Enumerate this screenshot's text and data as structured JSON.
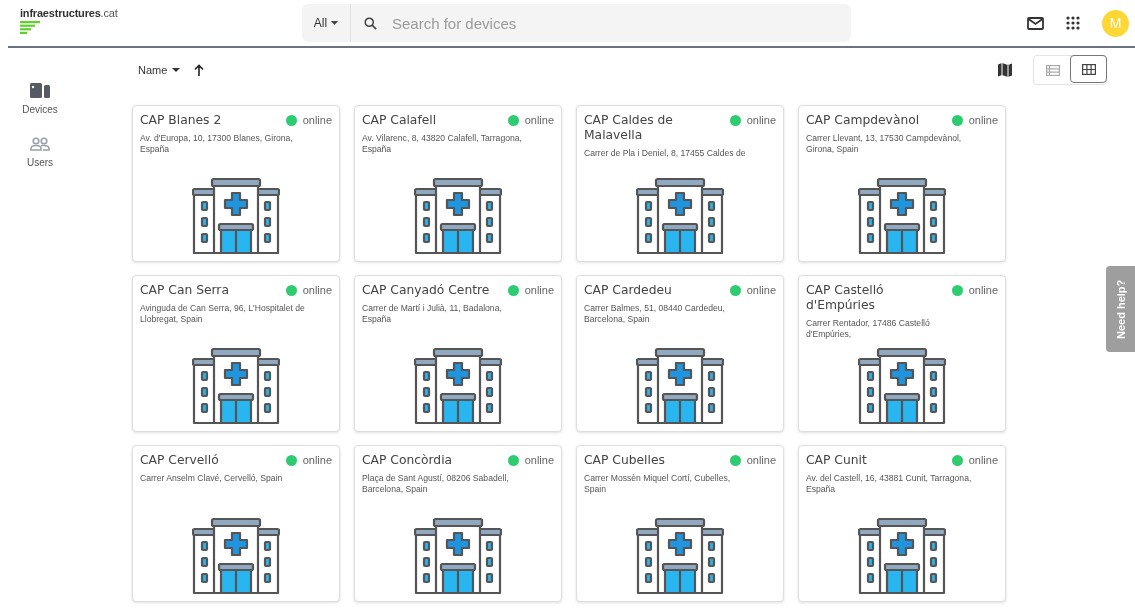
{
  "header": {
    "logo": {
      "name": "infraestructures",
      "suffix": ".cat"
    },
    "search": {
      "scope": "All",
      "placeholder": "Search for devices"
    },
    "avatar": "M"
  },
  "sidebar": {
    "items": [
      {
        "label": "Devices",
        "kind": "devices",
        "selected": true
      },
      {
        "label": "Users",
        "kind": "users",
        "selected": false
      }
    ]
  },
  "toolbar": {
    "sort_field": "Name",
    "views": [
      {
        "kind": "list",
        "selected": false
      },
      {
        "kind": "grid",
        "selected": true
      }
    ]
  },
  "devices": [
    {
      "name": "CAP Blanes 2",
      "status": "online",
      "online": true,
      "address": "Av. d'Europa, 10, 17300 Blanes, Girona, España"
    },
    {
      "name": "CAP Calafell",
      "status": "online",
      "online": true,
      "address": "Av. Vilarenc, 8, 43820 Calafell, Tarragona, España"
    },
    {
      "name": "CAP Caldes de Malavella",
      "status": "online",
      "online": true,
      "address": "Carrer de Pla i Deniel, 8, 17455 Caldes de"
    },
    {
      "name": "CAP Campdevànol",
      "status": "online",
      "online": true,
      "address": "Carrer Llevant, 13, 17530 Campdevànol, Girona, Spain"
    },
    {
      "name": "CAP Can Serra",
      "status": "online",
      "online": true,
      "address": "Avinguda de Can Serra, 96, L'Hospitalet de Llobregat, Spain"
    },
    {
      "name": "CAP Canyadó Centre",
      "status": "online",
      "online": true,
      "address": "Carrer de Martí i Julià, 11, Badalona, España"
    },
    {
      "name": "CAP Cardedeu",
      "status": "online",
      "online": true,
      "address": "Carrer Balmes, 51, 08440 Cardedeu, Barcelona, Spain"
    },
    {
      "name": "CAP Castelló d'Empúries",
      "status": "online",
      "online": true,
      "address": "Carrer Rentador, 17486 Castelló d'Empúries,"
    },
    {
      "name": "CAP Cervelló",
      "status": "online",
      "online": true,
      "address": "Carrer Anselm Clavé, Cervelló, Spain"
    },
    {
      "name": "CAP Concòrdia",
      "status": "online",
      "online": true,
      "address": "Plaça de Sant Agustí, 08206 Sabadell, Barcelona, Spain"
    },
    {
      "name": "CAP Cubelles",
      "status": "online",
      "online": true,
      "address": "Carrer Mossèn Miquel Cortí, Cubelles, Spain"
    },
    {
      "name": "CAP Cunit",
      "status": "online",
      "online": true,
      "address": "Av. del Castell, 16, 43881 Cunit, Tarragona, España"
    }
  ],
  "help_tab": "Need help?"
}
